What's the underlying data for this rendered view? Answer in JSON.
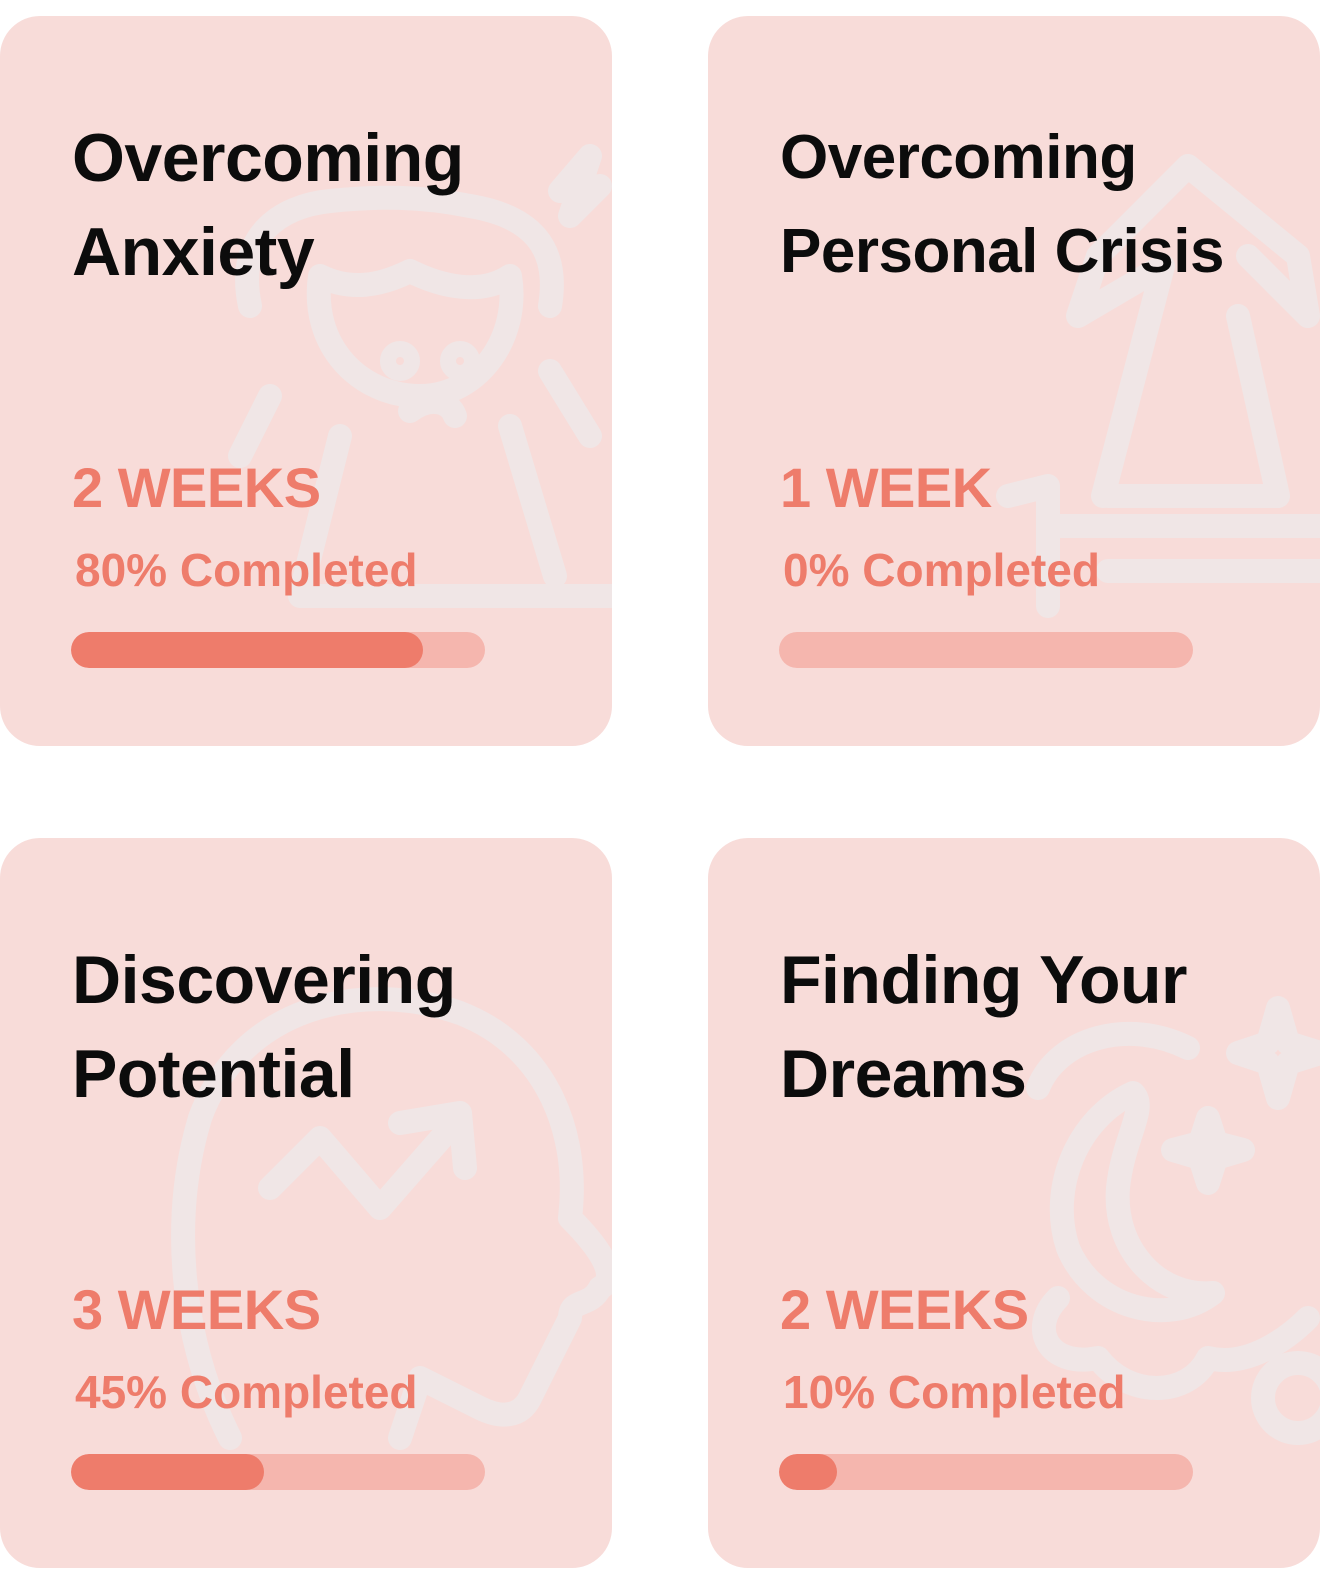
{
  "colors": {
    "card_background": "#f8dcd9",
    "accent": "#ee7c6b",
    "progress_track": "#f5b6ae",
    "title_text": "#0c0c0c"
  },
  "programs": [
    {
      "title_line1": "Overcoming",
      "title_line2": "Anxiety",
      "duration": "2 WEEKS",
      "completed_label": "80% Completed",
      "progress": 0.85,
      "icon": "anxious-person-icon"
    },
    {
      "title_line1": "Overcoming",
      "title_line2": "Personal Crisis",
      "duration": "1 WEEK",
      "completed_label": "0% Completed",
      "progress": 0,
      "icon": "falling-person-icon"
    },
    {
      "title_line1": "Discovering",
      "title_line2": "Potential",
      "duration": "3 WEEKS",
      "completed_label": "45% Completed",
      "progress": 0.465,
      "icon": "head-growth-arrow-icon"
    },
    {
      "title_line1": "Finding Your",
      "title_line2": "Dreams",
      "duration": "2 WEEKS",
      "completed_label": "10% Completed",
      "progress": 0.14,
      "icon": "moon-stars-cloud-icon"
    }
  ]
}
